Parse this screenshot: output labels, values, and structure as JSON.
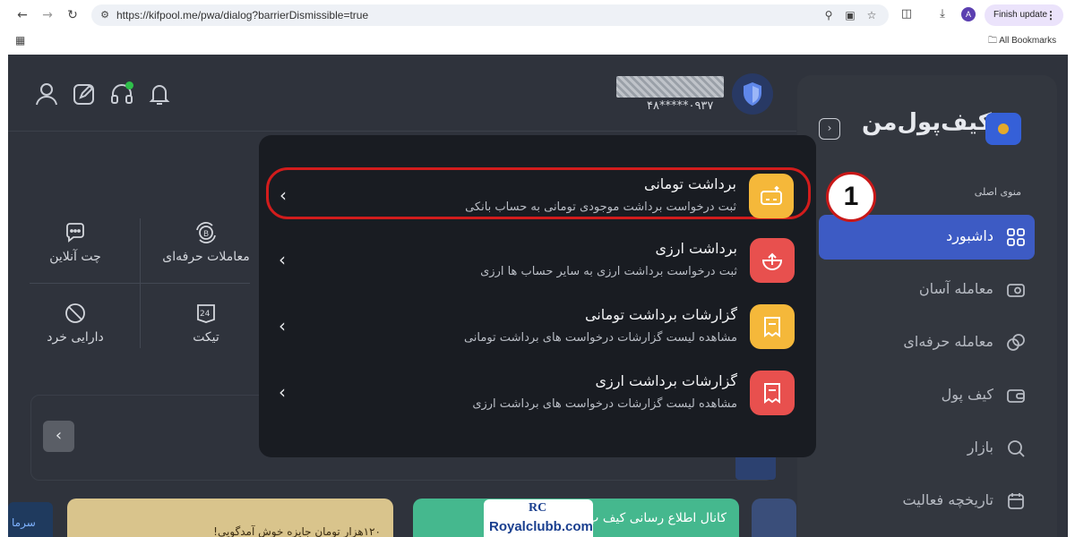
{
  "browser": {
    "url": "https://kifpool.me/pwa/dialog?barrierDismissible=true",
    "profile_initial": "A",
    "finish_update_label": "Finish update",
    "bookmarks_label": "All Bookmarks"
  },
  "header": {
    "phone_masked": "۰۹۳۷*****۴۸"
  },
  "sidebar": {
    "logo_text": "کیف‌پول‌من",
    "menu_caption": "منوی اصلی",
    "items": [
      {
        "label": "داشبورد",
        "icon": "dashboard-icon",
        "active": true
      },
      {
        "label": "معامله آسان",
        "icon": "easy-trade-icon",
        "active": false
      },
      {
        "label": "معامله حرفه‌ای",
        "icon": "pro-trade-icon",
        "active": false
      },
      {
        "label": "کیف پول",
        "icon": "wallet-icon",
        "active": false
      },
      {
        "label": "بازار",
        "icon": "market-icon",
        "active": false
      },
      {
        "label": "تاریخچه فعالیت",
        "icon": "history-icon",
        "active": false
      }
    ]
  },
  "quick_actions": [
    {
      "label": "چت آنلاین",
      "icon": "chat-icon"
    },
    {
      "label": "معاملات حرفه‌ای",
      "icon": "bitcoin-exchange-icon"
    },
    {
      "label": "دارایی خرد",
      "icon": "small-assets-icon"
    },
    {
      "label": "تیکت",
      "icon": "ticket-24-icon"
    }
  ],
  "ticket_badge": "24",
  "banners": {
    "left_text": "۱۲۰هزار تومان جایزه خوش آمدگویی!",
    "middle_text": "کانال اطلاع رسانی کیف پ",
    "edge_text": "سرما"
  },
  "dialog": {
    "options": [
      {
        "title": "برداشت تومانی",
        "description": "ثبت درخواست برداشت موجودی تومانی به حساب بانکی",
        "icon": "toman-withdraw-icon",
        "color": "#f5b83a"
      },
      {
        "title": "برداشت ارزی",
        "description": "ثبت درخواست برداشت ارزی به سایر حساب ها ارزی",
        "icon": "crypto-withdraw-icon",
        "color": "#e8504e"
      },
      {
        "title": "گزارشات برداشت تومانی",
        "description": "مشاهده لیست گزارشات درخواست های برداشت تومانی",
        "icon": "toman-report-icon",
        "color": "#f5b83a"
      },
      {
        "title": "گزارشات برداشت ارزی",
        "description": "مشاهده لیست گزارشات درخواست های برداشت ارزی",
        "icon": "crypto-report-icon",
        "color": "#e8504e"
      }
    ]
  },
  "annotation": {
    "step_number": "1"
  },
  "watermark": {
    "mark": "RC",
    "site": "Royalclubb.com"
  }
}
